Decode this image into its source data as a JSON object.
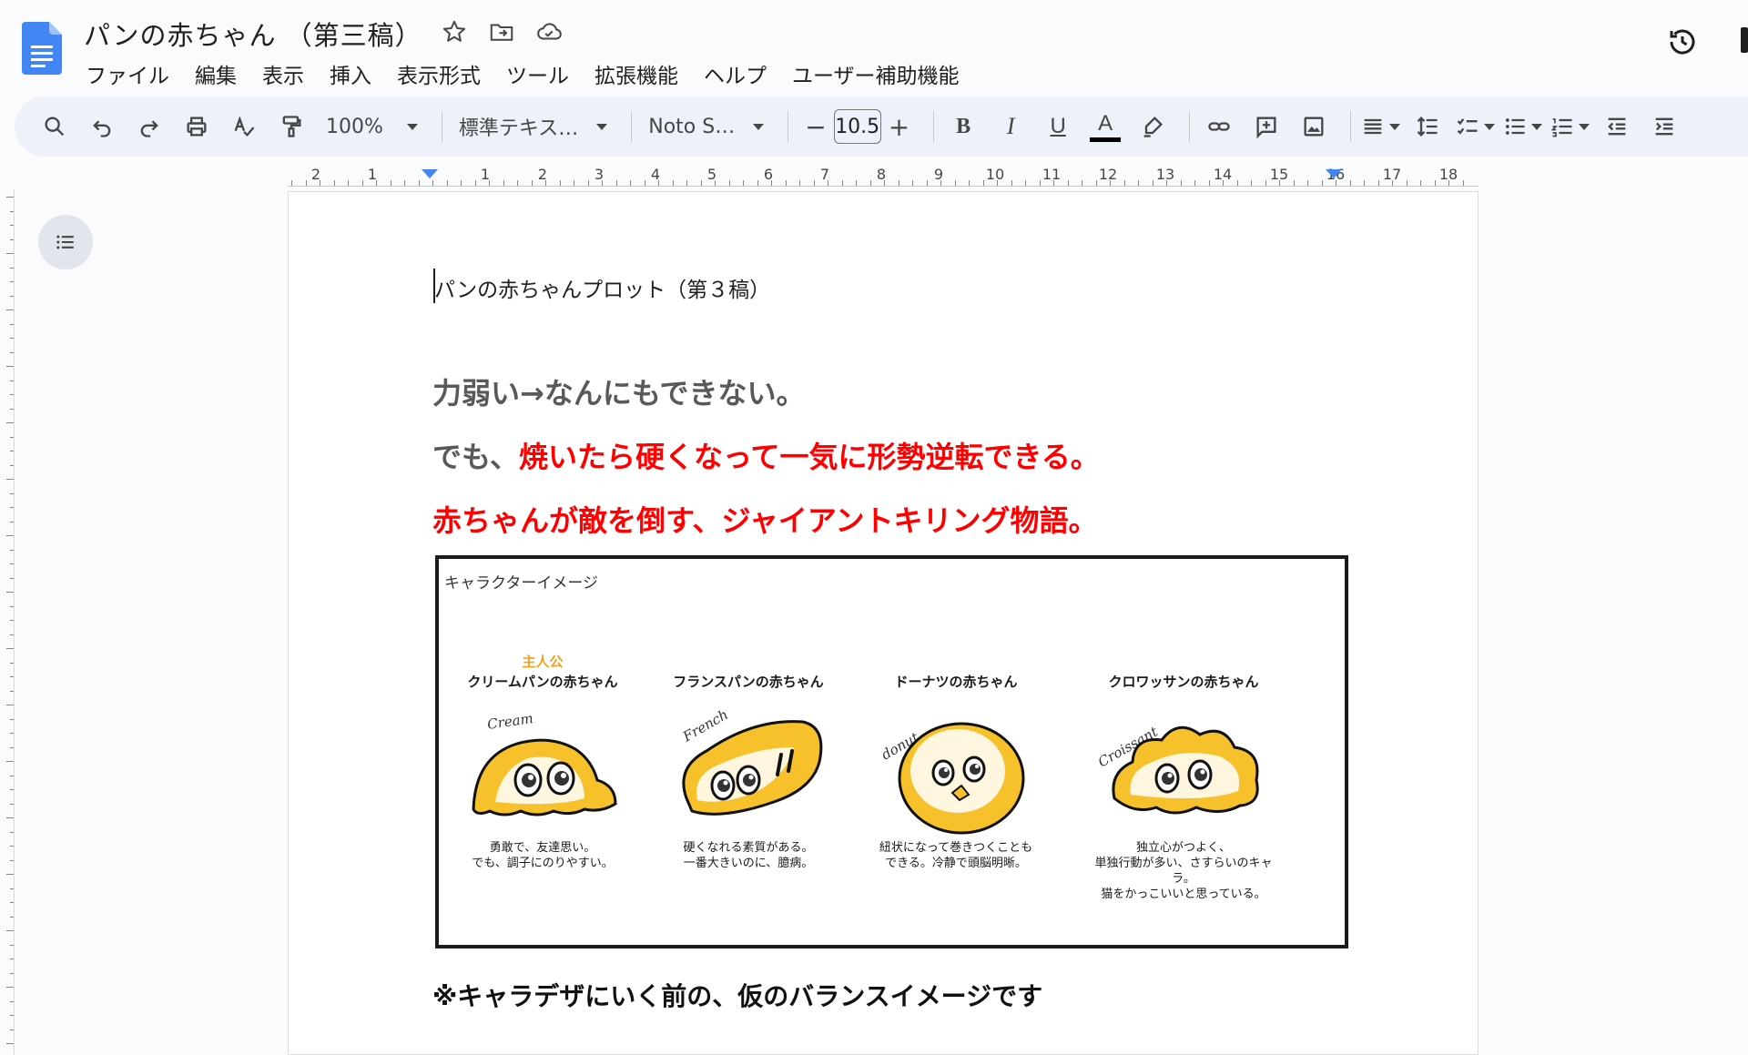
{
  "doc": {
    "title": "パンの赤ちゃん （第三稿）"
  },
  "menu": [
    "ファイル",
    "編集",
    "表示",
    "挿入",
    "表示形式",
    "ツール",
    "拡張機能",
    "ヘルプ",
    "ユーザー補助機能"
  ],
  "toolbar": {
    "zoom": "100%",
    "style": "標準テキス…",
    "font": "Noto S…",
    "font_size": "10.5",
    "minus": "−",
    "plus": "+",
    "bold": "B",
    "italic": "I",
    "underline": "U",
    "text_color": "A"
  },
  "ruler": {
    "numbers": [
      "2",
      "1",
      "1",
      "2",
      "3",
      "4",
      "5",
      "6",
      "7",
      "8",
      "9",
      "10",
      "11",
      "12",
      "13",
      "14",
      "15",
      "16",
      "17",
      "18"
    ]
  },
  "page": {
    "heading": "パンの赤ちゃんプロット（第３稿）",
    "line1": "力弱い→なんにもできない。",
    "line2_gray": "でも、",
    "line2_red": "焼いたら硬くなって一気に形勢逆転できる。",
    "line3": "赤ちゃんが敵を倒す、ジャイアントキリング物語。",
    "figure_label": "キャラクターイメージ",
    "characters": [
      {
        "badge": "主人公",
        "name": "クリームパンの赤ちゃん",
        "sign": "Cream",
        "desc1": "勇敢で、友達思い。",
        "desc2": "でも、調子にのりやすい。",
        "desc3": ""
      },
      {
        "badge": "",
        "name": "フランスパンの赤ちゃん",
        "sign": "French",
        "desc1": "硬くなれる素質がある。",
        "desc2": "一番大きいのに、臆病。",
        "desc3": ""
      },
      {
        "badge": "",
        "name": "ドーナツの赤ちゃん",
        "sign": "donut",
        "desc1": "紐状になって巻きつくことも",
        "desc2": "できる。冷静で頭脳明晰。",
        "desc3": ""
      },
      {
        "badge": "",
        "name": "クロワッサンの赤ちゃん",
        "sign": "Croissant",
        "desc1": "独立心がつよく、",
        "desc2": "単独行動が多い、さすらいのキャラ。",
        "desc3": "猫をかっこいいと思っている。"
      }
    ],
    "note": "※キャラデザにいく前の、仮のバランスイメージです"
  },
  "colors": {
    "accent_red": "#ff0000",
    "gray_text": "#595959",
    "badge_orange": "#f2a11a",
    "bread_yellow": "#f6c12b",
    "docs_blue": "#4285f4"
  }
}
